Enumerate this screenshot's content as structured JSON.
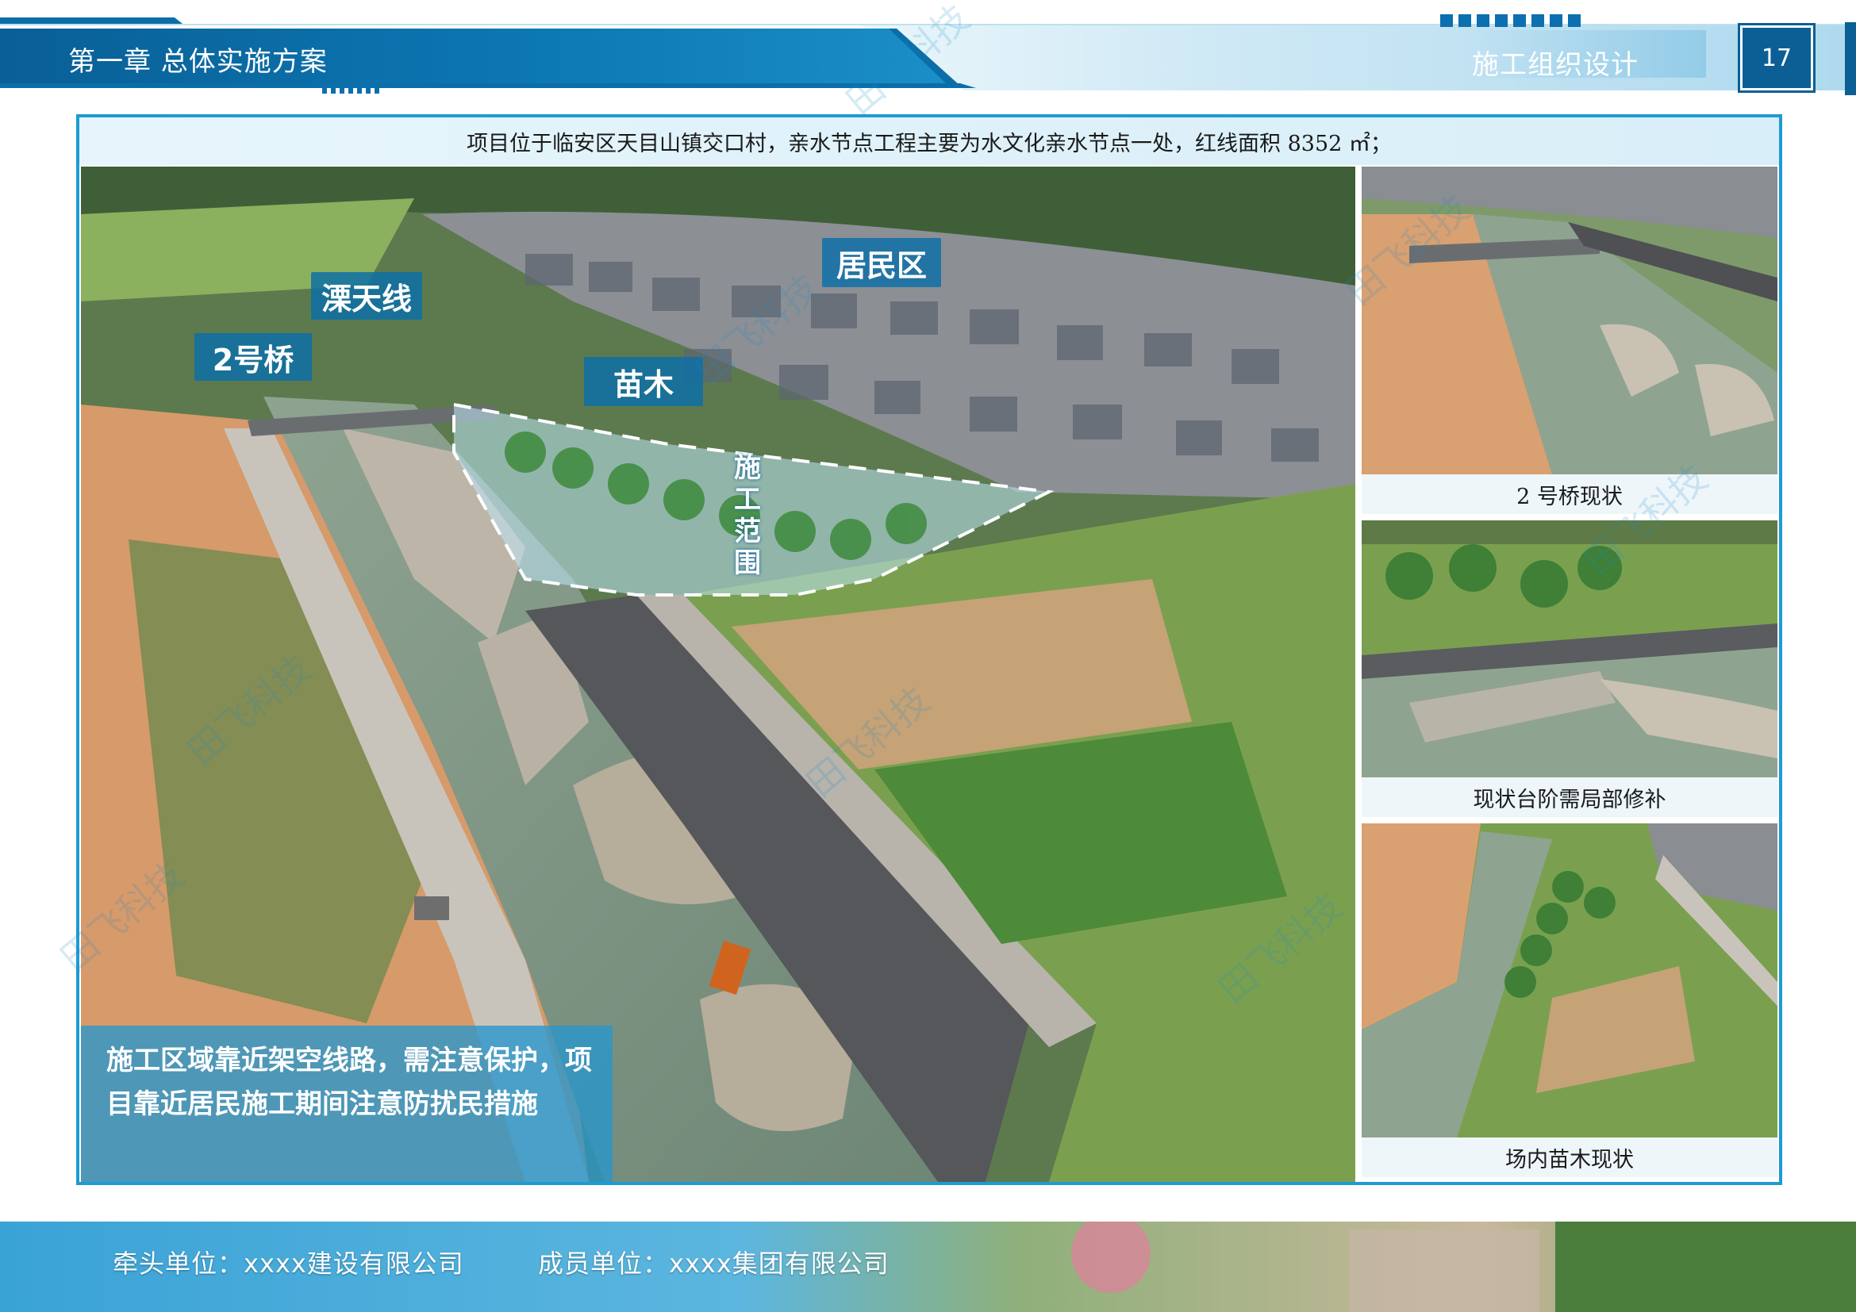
{
  "header": {
    "chapter": "第一章  总体实施方案",
    "section": "施工组织设计",
    "page_number": "17"
  },
  "caption": "项目位于临安区天目山镇交口村，亲水节点工程主要为水文化亲水节点一处，红线面积 8352 ㎡；",
  "main_photo": {
    "labels": {
      "bridge2": "2号桥",
      "power_line": "溧天线",
      "residential": "居民区",
      "nursery": "苗木",
      "construction_zone": [
        "施",
        "工",
        "范",
        "围"
      ]
    },
    "note": "施工区域靠近架空线路，需注意保护，项目靠近居民施工期间注意防扰民措施"
  },
  "side_photos": [
    {
      "caption": "2 号桥现状"
    },
    {
      "caption": "现状台阶需局部修补"
    },
    {
      "caption": "场内苗木现状"
    }
  ],
  "footer": {
    "lead_unit": "牵头单位：xxxx建设有限公司",
    "member_unit": "成员单位：xxxx集团有限公司"
  },
  "watermark": "田飞科技",
  "colors": {
    "brand_blue": "#0b6ea8",
    "frame_blue": "#1e9bd3",
    "caption_bg": "#e6f5fb"
  }
}
